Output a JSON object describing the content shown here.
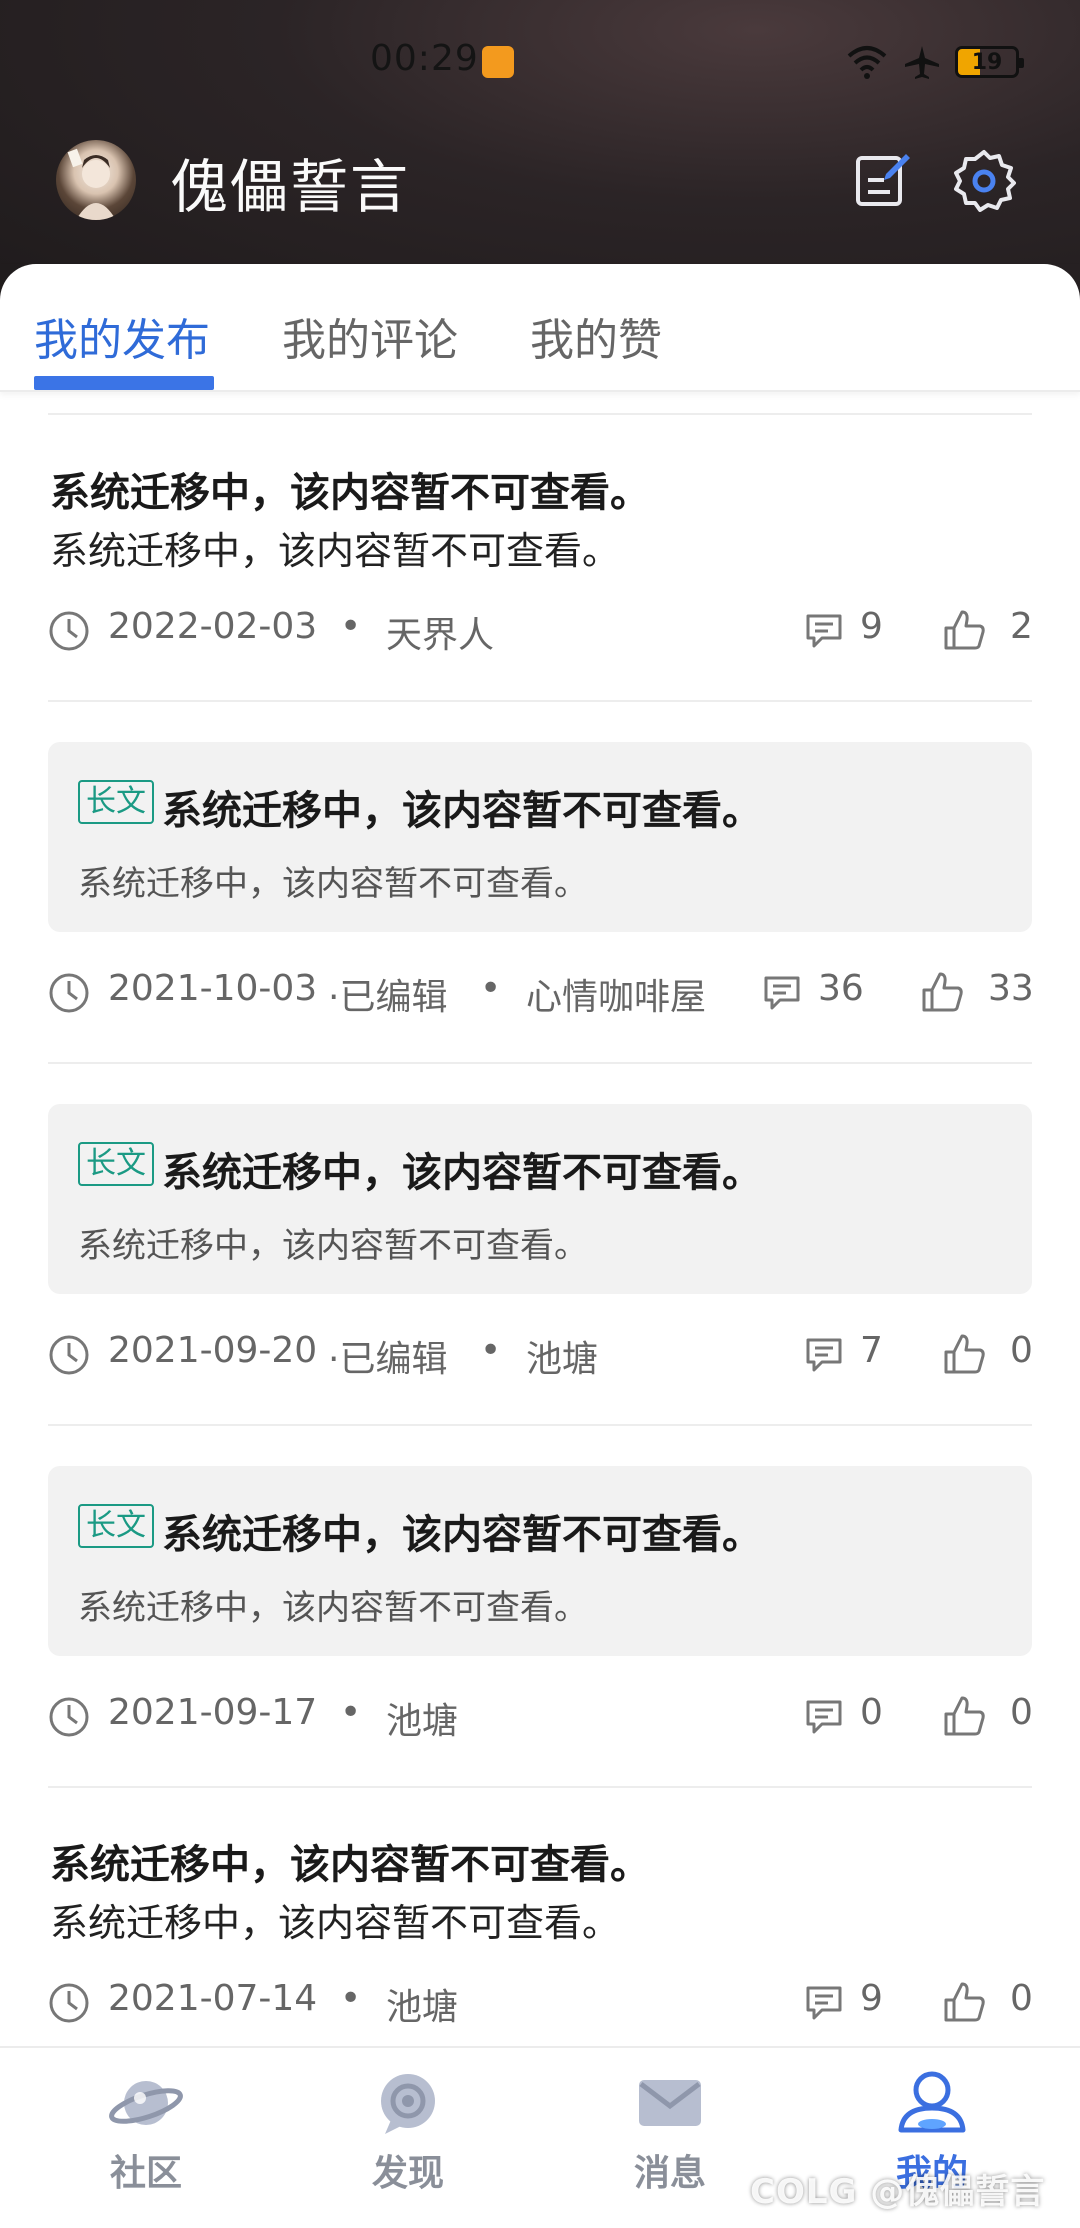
{
  "status_bar": {
    "time": "00:29",
    "battery": "19"
  },
  "header": {
    "user_name": "傀儡誓言"
  },
  "tabs": [
    {
      "label": "我的发布"
    },
    {
      "label": "我的评论"
    },
    {
      "label": "我的赞"
    }
  ],
  "posts": [
    {
      "type": "plain",
      "title": "系统迁移中，该内容暂不可查看。",
      "body": "系统迁移中，该内容暂不可查看。",
      "date": "2022-02-03",
      "edited": "",
      "board": "天界人",
      "comments": "9",
      "likes": "2"
    },
    {
      "type": "long",
      "tag": "长文",
      "title": "系统迁移中，该内容暂不可查看。",
      "body": "系统迁移中，该内容暂不可查看。",
      "date": "2021-10-03",
      "edited": "·已编辑",
      "board": "心情咖啡屋",
      "comments": "36",
      "likes": "33"
    },
    {
      "type": "long",
      "tag": "长文",
      "title": "系统迁移中，该内容暂不可查看。",
      "body": "系统迁移中，该内容暂不可查看。",
      "date": "2021-09-20",
      "edited": "·已编辑",
      "board": "池塘",
      "comments": "7",
      "likes": "0"
    },
    {
      "type": "long",
      "tag": "长文",
      "title": "系统迁移中，该内容暂不可查看。",
      "body": "系统迁移中，该内容暂不可查看。",
      "date": "2021-09-17",
      "edited": "",
      "board": "池塘",
      "comments": "0",
      "likes": "0"
    },
    {
      "type": "plain",
      "title": "系统迁移中，该内容暂不可查看。",
      "body": "系统迁移中，该内容暂不可查看。",
      "date": "2021-07-14",
      "edited": "",
      "board": "池塘",
      "comments": "9",
      "likes": "0"
    }
  ],
  "bottom_nav": [
    {
      "label": "社区",
      "icon": "planet-icon"
    },
    {
      "label": "发现",
      "icon": "discover-icon"
    },
    {
      "label": "消息",
      "icon": "mail-icon"
    },
    {
      "label": "我的",
      "icon": "profile-icon",
      "active": true
    }
  ],
  "watermark": "COLG @傀儡誓言",
  "colors": {
    "accent": "#3b74e6",
    "tag": "#1b9a84",
    "header_bg": "#2b2426"
  }
}
